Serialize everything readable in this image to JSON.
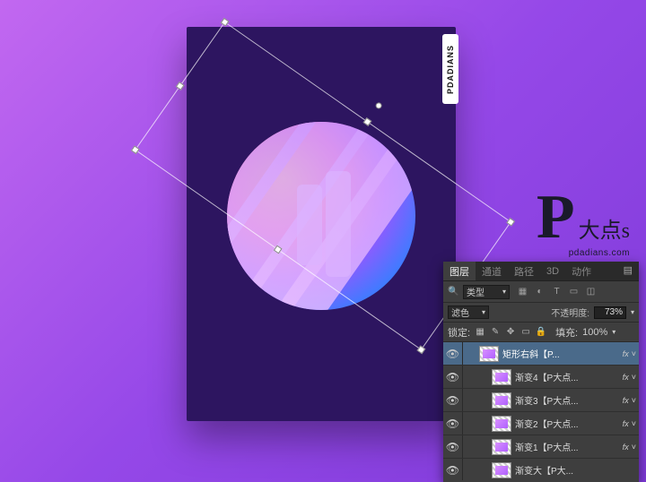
{
  "poster": {
    "tab_label": "PDADIANS"
  },
  "watermark": {
    "p": "P",
    "suffix": "大点s",
    "url": "pdadians.com"
  },
  "panel": {
    "tabs": [
      "图层",
      "通道",
      "路径",
      "3D",
      "动作"
    ],
    "active_tab": 0,
    "filter_label": "类型",
    "filter_icons": [
      "image-icon",
      "adjust-icon",
      "text-icon",
      "shape-icon",
      "smart-icon"
    ],
    "blend_label": "滤色",
    "opacity_label": "不透明度:",
    "opacity_value": "73%",
    "lock_label": "锁定:",
    "fill_label": "填充:",
    "fill_value": "100%",
    "layers": [
      {
        "name": "矩形右斜【P...",
        "active": true,
        "indent": 1,
        "fx": true
      },
      {
        "name": "渐变4【P大点...",
        "active": false,
        "indent": 2,
        "fx": true
      },
      {
        "name": "渐变3【P大点...",
        "active": false,
        "indent": 2,
        "fx": true
      },
      {
        "name": "渐变2【P大点...",
        "active": false,
        "indent": 2,
        "fx": true
      },
      {
        "name": "渐变1【P大点...",
        "active": false,
        "indent": 2,
        "fx": true
      },
      {
        "name": "渐变大【P大...",
        "active": false,
        "indent": 2,
        "fx": false
      }
    ]
  }
}
